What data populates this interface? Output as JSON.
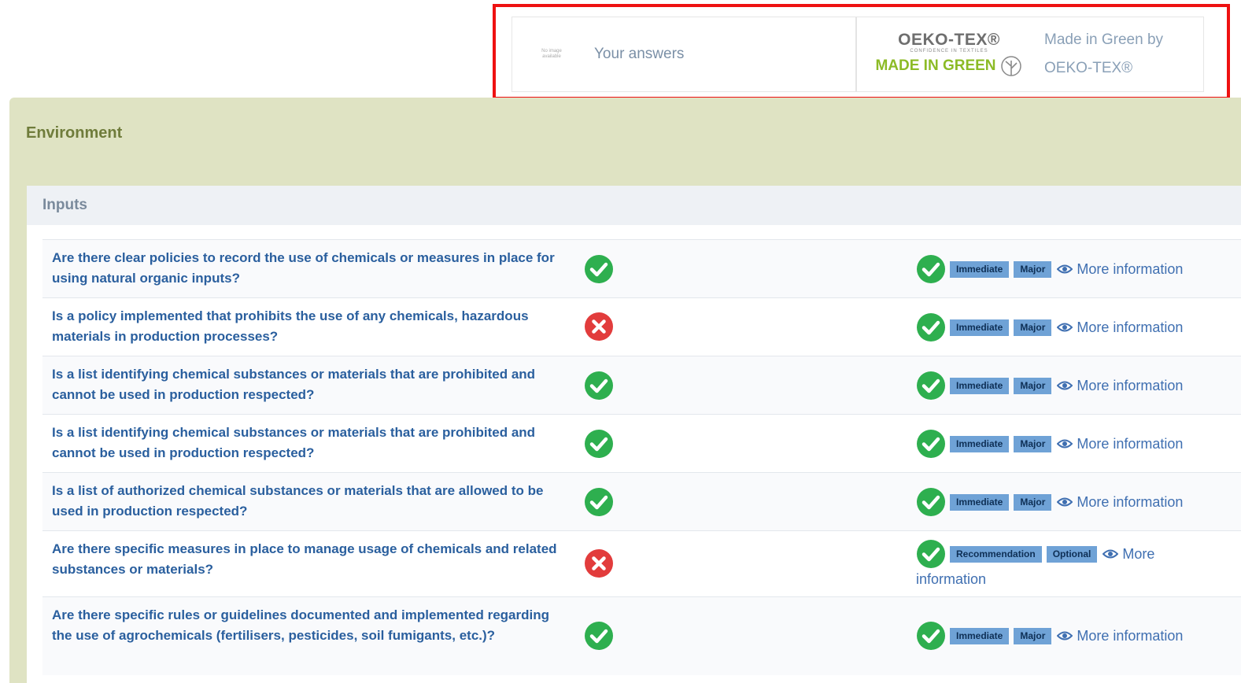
{
  "header": {
    "no_image_text": "No image available",
    "answers_label": "Your answers",
    "certification": {
      "brand": "OEKO-TEX®",
      "tagline": "CONFIDENCE IN TEXTILES",
      "label": "MADE IN GREEN",
      "title_line1": "Made in Green by",
      "title_line2": "OEKO-TEX®"
    },
    "highlight_color": "#ee1111"
  },
  "section": {
    "title": "Environment"
  },
  "subsection": {
    "title": "Inputs"
  },
  "questions": [
    {
      "text": "Are there clear policies to record the use of chemicals or measures in place for using natural organic inputs?",
      "answer": "yes",
      "evaluation": "yes",
      "tags": [
        "Immediate",
        "Major"
      ],
      "more_label": "More information"
    },
    {
      "text": "Is a policy implemented that prohibits the use of any chemicals, hazardous materials in production processes?",
      "answer": "no",
      "evaluation": "yes",
      "tags": [
        "Immediate",
        "Major"
      ],
      "more_label": "More information"
    },
    {
      "text": "Is a list identifying chemical substances or materials that are prohibited and cannot be used in production respected?",
      "answer": "yes",
      "evaluation": "yes",
      "tags": [
        "Immediate",
        "Major"
      ],
      "more_label": "More information"
    },
    {
      "text": "Is a list identifying chemical substances or materials that are prohibited and cannot be used in production respected?",
      "answer": "yes",
      "evaluation": "yes",
      "tags": [
        "Immediate",
        "Major"
      ],
      "more_label": "More information"
    },
    {
      "text": "Is a list of authorized chemical substances or materials that are allowed to be used in production respected?",
      "answer": "yes",
      "evaluation": "yes",
      "tags": [
        "Immediate",
        "Major"
      ],
      "more_label": "More information"
    },
    {
      "text": "Are there specific measures in place to manage usage of chemicals and related substances or materials?",
      "answer": "no",
      "evaluation": "yes",
      "tags": [
        "Recommendation",
        "Optional"
      ],
      "more_label_line1": "More",
      "more_label_line2": "information"
    },
    {
      "text": "Are there specific rules or guidelines documented and implemented regarding the use of agrochemicals (fertilisers, pesticides, soil fumigants, etc.)?",
      "answer": "yes",
      "evaluation": "yes",
      "tags": [
        "Immediate",
        "Major"
      ],
      "more_label": "More information"
    }
  ],
  "colors": {
    "yes": "#2eaf4f",
    "no": "#e23c3c",
    "badge": "#6fa2d6",
    "link": "#3f6fb1",
    "question": "#2a5f9e"
  },
  "icons": {
    "yes": "check-circle-icon",
    "no": "x-circle-icon",
    "more": "eye-icon",
    "cert": "leaf-icon"
  }
}
